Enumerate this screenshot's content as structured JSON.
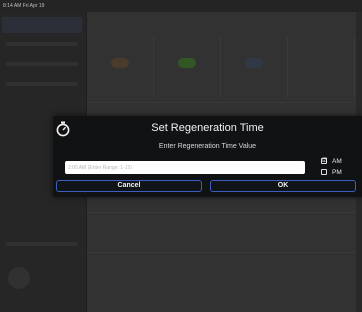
{
  "status_bar": {
    "time_date": "8:14 AM   Fri Apr 19"
  },
  "background": {
    "tile_colors": [
      "#5a4a36",
      "#3f6a2e",
      "#3c4658",
      "#3e3e3e"
    ]
  },
  "dialog": {
    "title": "Set Regeneration Time",
    "subtitle": "Enter Regeneration Time Value",
    "time_input": {
      "value": "",
      "placeholder": "2:00 AM (Enter Range: 1-12)"
    },
    "am": {
      "label": "AM",
      "checked": true,
      "mark": "☑"
    },
    "pm": {
      "label": "PM",
      "checked": false,
      "mark": ""
    },
    "cancel_label": "Cancel",
    "ok_label": "OK",
    "accent_color": "#3c5fbf"
  }
}
